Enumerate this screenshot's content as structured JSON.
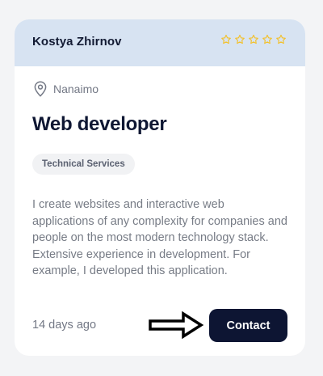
{
  "card": {
    "author_name": "Kostya Zhirnov",
    "rating": {
      "filled": 0,
      "max": 5,
      "star_color": "#f2c12e",
      "star_icon": "star-outline-icon"
    },
    "location": {
      "icon": "location-pin-icon",
      "text": "Nanaimo"
    },
    "job_title": "Web developer",
    "category": "Technical Services",
    "description": "I create websites and interactive web applications of any complexity for companies and people on the most modern technology stack. Extensive experience in development. For example, I developed this application.",
    "posted": "14 days ago",
    "arrow_icon": "arrow-right-icon",
    "contact_label": "Contact"
  },
  "colors": {
    "page_background": "#f3f4f6",
    "header_background": "#d7e3f2",
    "button_background": "#0d1533",
    "title_color": "#0f1733",
    "muted_text": "#777c86"
  }
}
